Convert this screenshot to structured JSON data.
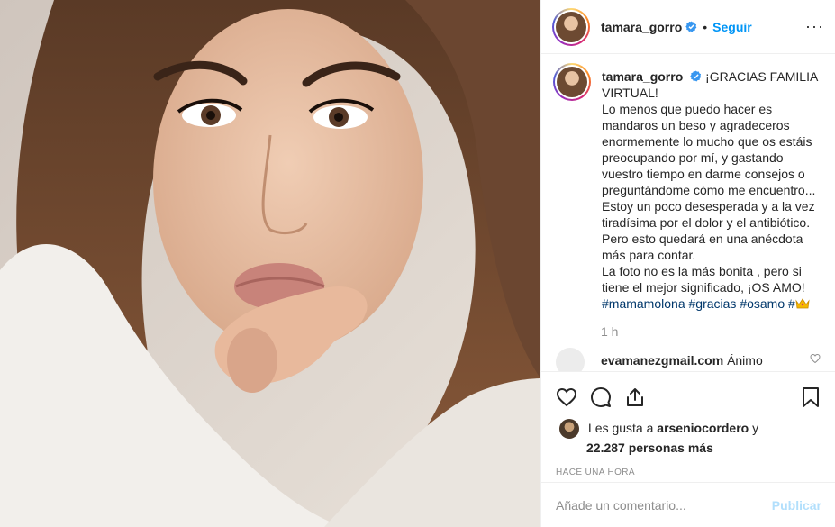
{
  "post": {
    "username": "tamara_gorro",
    "follow_label": "Seguir",
    "more_label": "···",
    "caption_lines": [
      "¡GRACIAS FAMILIA",
      "VIRTUAL!",
      "Lo menos que puedo hacer es",
      "mandaros un beso y agradeceros",
      "enormemente lo mucho que os estáis",
      "preocupando por mí, y gastando",
      "vuestro tiempo en darme consejos o",
      "preguntándome cómo me encuentro...",
      "Estoy un poco desesperada y a la vez",
      "tiradísima por el dolor y el antibiótico.",
      "Pero esto quedará en una anécdota",
      "más para contar.",
      "La foto no es la más bonita , pero si",
      "tiene el mejor significado, ¡OS AMO!"
    ],
    "hashtags": [
      "#mamamolona",
      "#gracias",
      "#osamo",
      "#"
    ],
    "caption_time": "1 h",
    "comment": {
      "username": "evamanezgmail.com",
      "text": "Ánimo"
    },
    "likes": {
      "prefix": "Les gusta a",
      "liker": "arseniocordero",
      "conj": "y",
      "count_text": "22.287 personas más"
    },
    "posted_ago": "HACE UNA HORA",
    "comment_input": {
      "placeholder": "Añade un comentario...",
      "value": ""
    },
    "publish_label": "Publicar"
  },
  "icons": {
    "verified": "verified-badge-icon",
    "like": "heart-icon",
    "comment": "comment-bubble-icon",
    "share": "share-icon",
    "save": "bookmark-icon",
    "crown": "crown-emoji-icon"
  },
  "colors": {
    "link_blue": "#0095f6",
    "hashtag_blue": "#00376b",
    "muted_gray": "#8e8e8e",
    "publish_disabled": "#b2dffc",
    "border": "#efefef"
  }
}
